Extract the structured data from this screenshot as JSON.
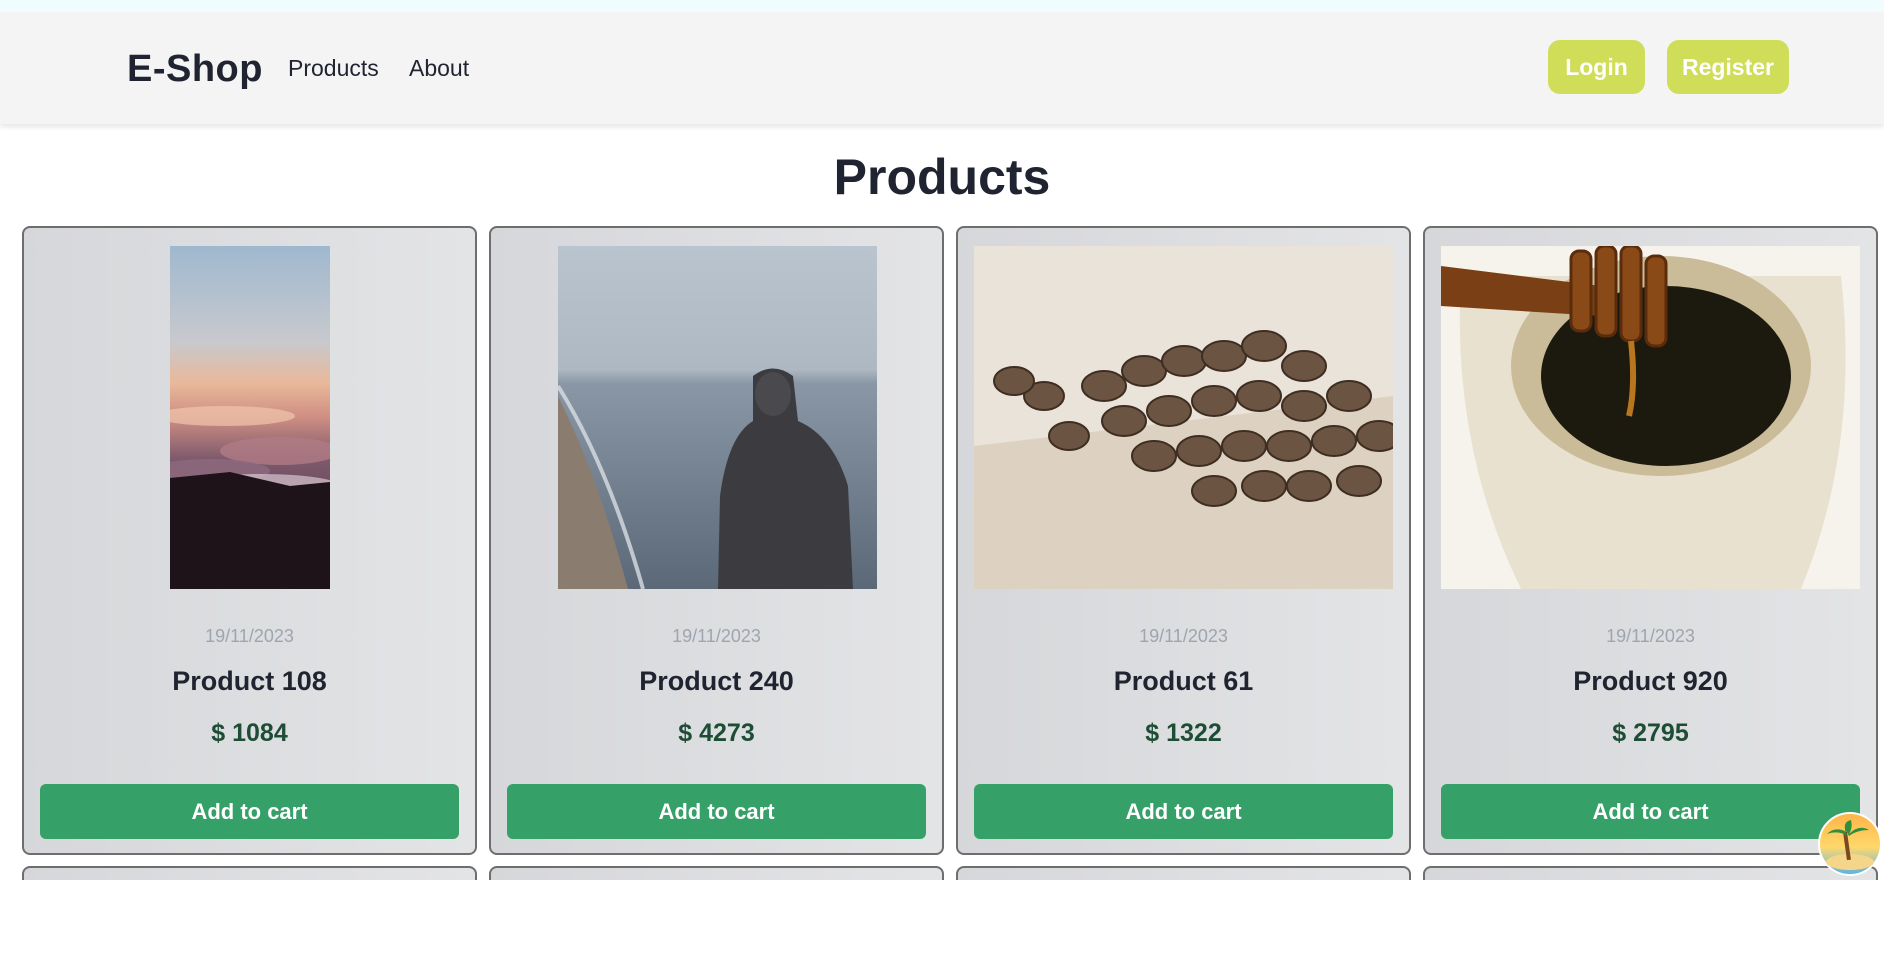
{
  "navbar": {
    "brand": "E-Shop",
    "links": [
      {
        "label": "Products"
      },
      {
        "label": "About"
      }
    ],
    "login_label": "Login",
    "register_label": "Register",
    "accent_color": "#d0dd58"
  },
  "main": {
    "title": "Products",
    "products": [
      {
        "date": "19/11/2023",
        "name": "Product 108",
        "price": "$ 1084",
        "button": "Add to cart",
        "image": "sunset-clouds-photo"
      },
      {
        "date": "19/11/2023",
        "name": "Product 240",
        "price": "$ 4273",
        "button": "Add to cart",
        "image": "hooded-person-beach-photo"
      },
      {
        "date": "19/11/2023",
        "name": "Product 61",
        "price": "$ 1322",
        "button": "Add to cart",
        "image": "coffee-beans-photo"
      },
      {
        "date": "19/11/2023",
        "name": "Product 920",
        "price": "$ 2795",
        "button": "Add to cart",
        "image": "honey-dipper-jar-photo"
      }
    ],
    "button_color": "#36a069",
    "price_color": "#1e4d36"
  },
  "floating_widget": {
    "icon": "beach-island-icon"
  }
}
